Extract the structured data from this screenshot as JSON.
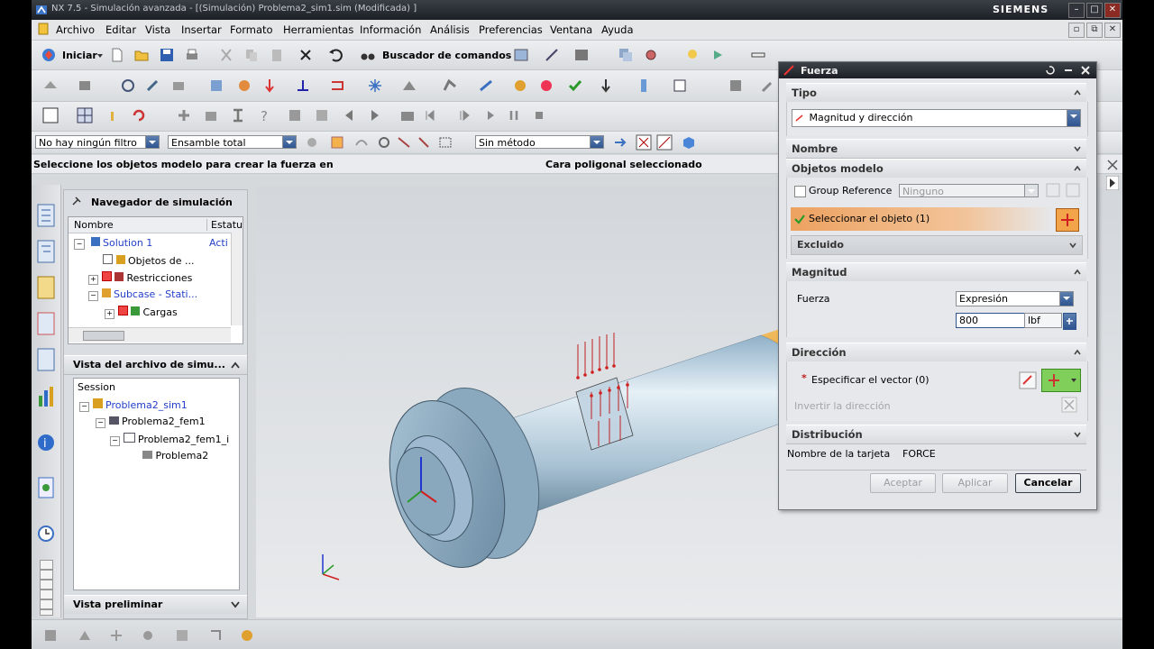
{
  "window": {
    "title": "NX 7.5 - Simulación avanzada - [(Simulación) Problema2_sim1.sim (Modificada) ]",
    "brand": "SIEMENS"
  },
  "menu": {
    "items": [
      "Archivo",
      "Editar",
      "Vista",
      "Insertar",
      "Formato",
      "Herramientas",
      "Información",
      "Análisis",
      "Preferencias",
      "Ventana",
      "Ayuda"
    ]
  },
  "toolbar": {
    "start_label": "Iniciar",
    "command_finder_label": "Buscador de comandos"
  },
  "selection_bar": {
    "filter": "No hay ningún filtro",
    "scope": "Ensamble total",
    "snap": "Sin método"
  },
  "cue_line": {
    "prompt": "Seleccione los objetos modelo para crear la fuerza en",
    "status": "Cara poligonal seleccionado"
  },
  "navigator": {
    "title": "Navegador de simulación",
    "columns": [
      "Nombre",
      "Estatus"
    ],
    "tree": [
      {
        "label": "Solution 1",
        "status": "Acti"
      },
      {
        "label": "Objetos de ..."
      },
      {
        "label": "Restricciones"
      },
      {
        "label": "Subcase - Stati..."
      },
      {
        "label": "Cargas"
      }
    ]
  },
  "file_view": {
    "title": "Vista del archivo de simu...",
    "items": [
      "Session",
      "Problema2_sim1",
      "Problema2_fem1",
      "Problema2_fem1_i",
      "Problema2"
    ]
  },
  "preview": {
    "title": "Vista preliminar"
  },
  "dialog": {
    "title": "Fuerza",
    "tipo": {
      "header": "Tipo",
      "value": "Magnitud y dirección"
    },
    "nombre": {
      "header": "Nombre"
    },
    "objetos": {
      "header": "Objetos modelo",
      "group_reference": "Group Reference",
      "group_value": "Ninguno",
      "select_object": "Seleccionar el objeto (1)",
      "excluded": "Excluido"
    },
    "magnitud": {
      "header": "Magnitud",
      "force_label": "Fuerza",
      "mode": "Expresión",
      "value": "800",
      "unit": "lbf"
    },
    "direccion": {
      "header": "Dirección",
      "specify_vector": "Especificar el vector (0)",
      "reverse": "Invertir la dirección"
    },
    "distribucion": {
      "header": "Distribución"
    },
    "card_name_label": "Nombre de la tarjeta",
    "card_name_value": "FORCE",
    "buttons": {
      "ok": "Aceptar",
      "apply": "Aplicar",
      "cancel": "Cancelar"
    }
  }
}
